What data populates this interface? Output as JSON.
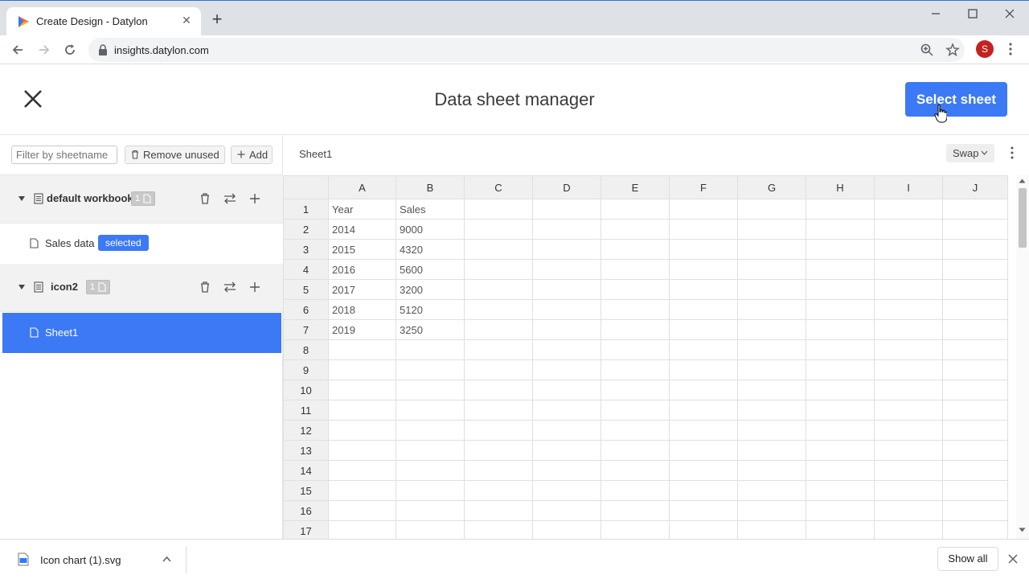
{
  "browser": {
    "tab_title": "Create Design - Datylon",
    "url": "insights.datylon.com",
    "avatar_letter": "S",
    "icons": {
      "tab_close": "close-icon",
      "new_tab": "plus-icon",
      "minimize": "minimize-icon",
      "maximize": "maximize-icon",
      "close": "close-icon",
      "back": "arrow-left-icon",
      "forward": "arrow-right-icon",
      "reload": "reload-icon",
      "lock": "lock-icon",
      "zoom": "zoom-icon",
      "bookmark": "star-icon",
      "menu": "kebab-menu-icon"
    }
  },
  "header": {
    "title": "Data sheet manager",
    "select_label": "Select sheet"
  },
  "left_toolbar": {
    "filter_placeholder": "Filter by sheetname",
    "remove_unused_label": "Remove unused",
    "add_label": "Add"
  },
  "workbooks": [
    {
      "name": "default workbook",
      "count": "1",
      "sheets": [
        {
          "name": "Sales data",
          "badge": "selected",
          "active": false
        }
      ]
    },
    {
      "name": "icon2",
      "count": "1",
      "sheets": [
        {
          "name": "Sheet1",
          "badge": "",
          "active": true
        }
      ]
    }
  ],
  "sheet_toolbar": {
    "sheet_name": "Sheet1",
    "swap_label": "Swap"
  },
  "grid": {
    "columns": [
      "A",
      "B",
      "C",
      "D",
      "E",
      "F",
      "G",
      "H",
      "I",
      "J"
    ],
    "row_numbers": [
      "1",
      "2",
      "3",
      "4",
      "5",
      "6",
      "7",
      "8",
      "9",
      "10",
      "11",
      "12",
      "13",
      "14",
      "15",
      "16",
      "17"
    ],
    "cells": [
      [
        "Year",
        "Sales"
      ],
      [
        "2014",
        "9000"
      ],
      [
        "2015",
        "4320"
      ],
      [
        "2016",
        "5600"
      ],
      [
        "2017",
        "3200"
      ],
      [
        "2018",
        "5120"
      ],
      [
        "2019",
        "3250"
      ]
    ]
  },
  "downloads": {
    "file_name": "Icon chart (1).svg",
    "show_all_label": "Show all"
  },
  "colors": {
    "accent": "#3c79f5",
    "header_bg": "#f0f0f0"
  }
}
